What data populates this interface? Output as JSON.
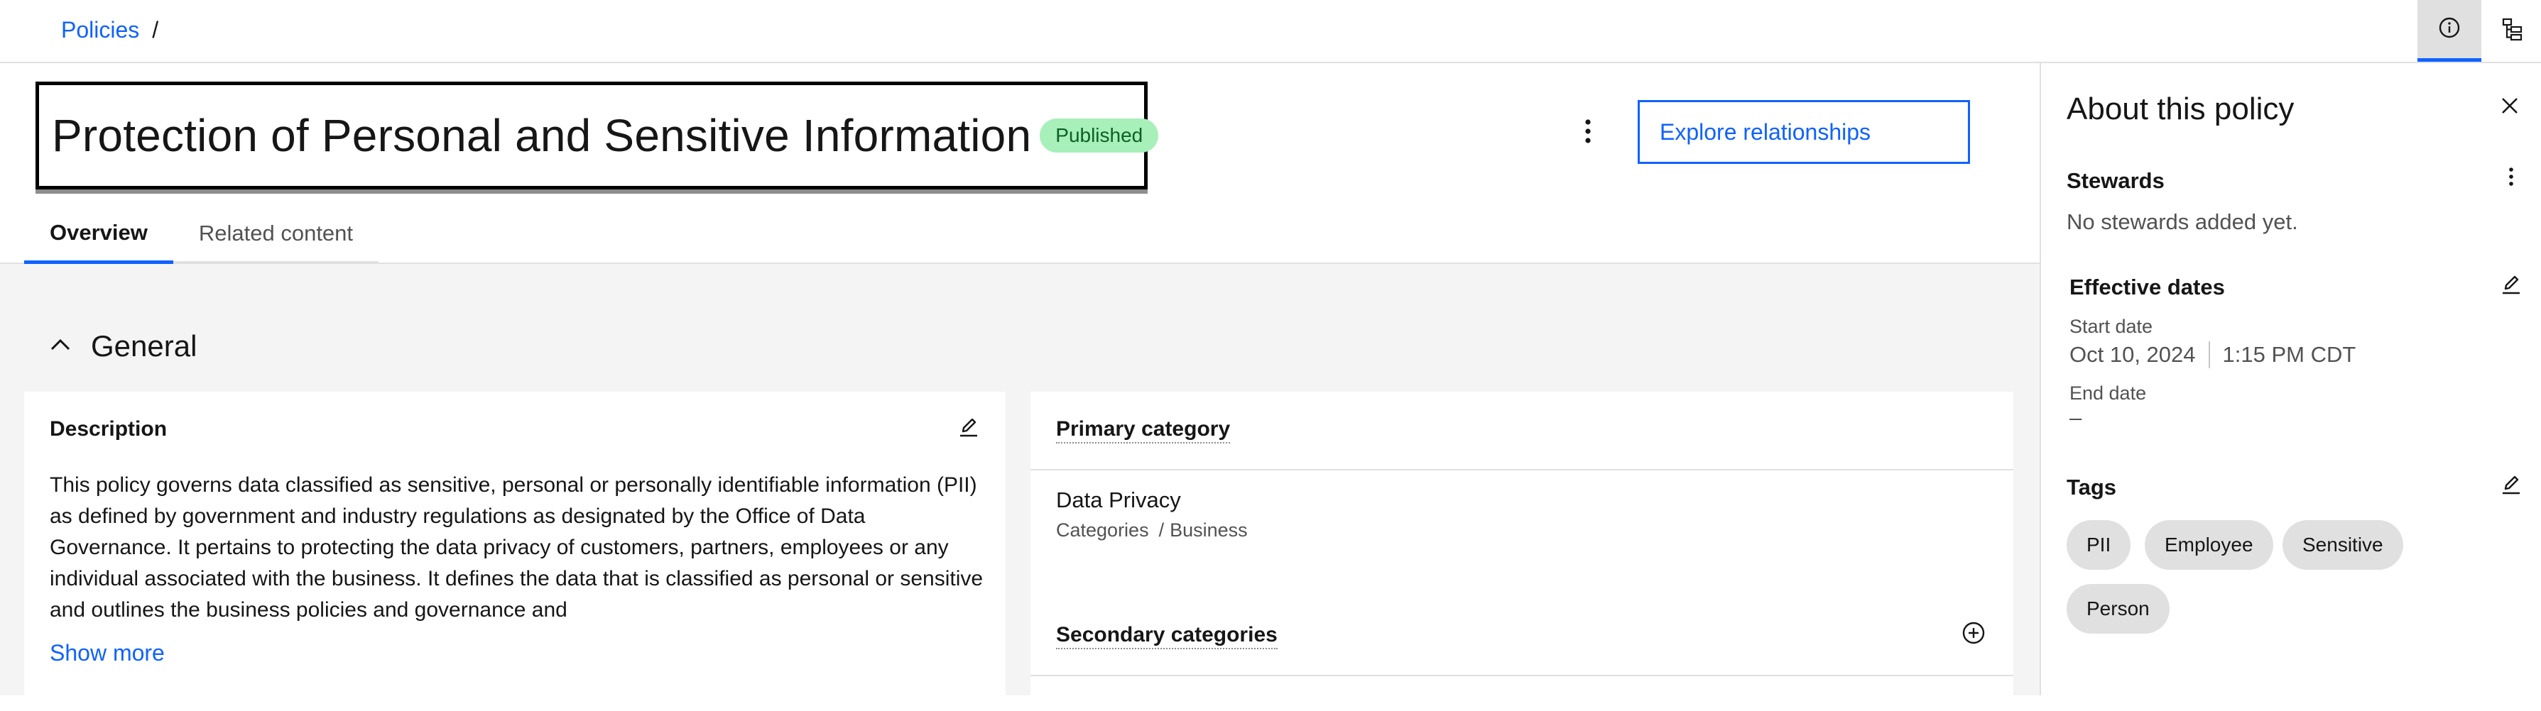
{
  "breadcrumb": {
    "items": [
      "Policies"
    ],
    "separator": "/"
  },
  "policy": {
    "title": "Protection of Personal and Sensitive Information",
    "status": "Published",
    "explore_label": "Explore relationships"
  },
  "tabs": [
    {
      "label": "Overview",
      "active": true
    },
    {
      "label": "Related content",
      "active": false
    }
  ],
  "general": {
    "section_label": "General",
    "description": {
      "title": "Description",
      "text": "This policy governs data classified as sensitive, personal or personally identifiable information (PII) as defined by government and industry regulations as designated by the Office of Data Governance. It pertains to protecting the data privacy of customers, partners, employees or any individual associated with the business. It defines the data that is classified as personal or sensitive and outlines the business policies and governance and",
      "show_more": "Show more"
    },
    "primary_category": {
      "title": "Primary category",
      "name": "Data Privacy",
      "path": [
        "Categories",
        "Business"
      ],
      "path_separator": "/"
    },
    "secondary_categories": {
      "title": "Secondary categories"
    }
  },
  "side_panel": {
    "title": "About this policy",
    "stewards": {
      "title": "Stewards",
      "empty_text": "No stewards added yet."
    },
    "effective_dates": {
      "title": "Effective dates",
      "start_label": "Start date",
      "start_date": "Oct 10, 2024",
      "start_time": "1:15 PM CDT",
      "end_label": "End date",
      "end_value": "–"
    },
    "tags": {
      "title": "Tags",
      "items": [
        "PII",
        "Employee",
        "Sensitive",
        "Person"
      ]
    }
  },
  "colors": {
    "accent": "#0f62fe",
    "badge_bg": "#a7f0ba",
    "badge_text": "#0e6027",
    "tag_bg": "#e0e0e0",
    "page_bg": "#f4f4f4"
  },
  "icons": {
    "info": "information-icon",
    "tree": "hierarchy-icon",
    "overflow": "overflow-menu-vertical-icon",
    "chevron": "chevron-up-icon",
    "edit": "edit-icon",
    "add": "add-circle-icon",
    "close": "close-icon"
  }
}
